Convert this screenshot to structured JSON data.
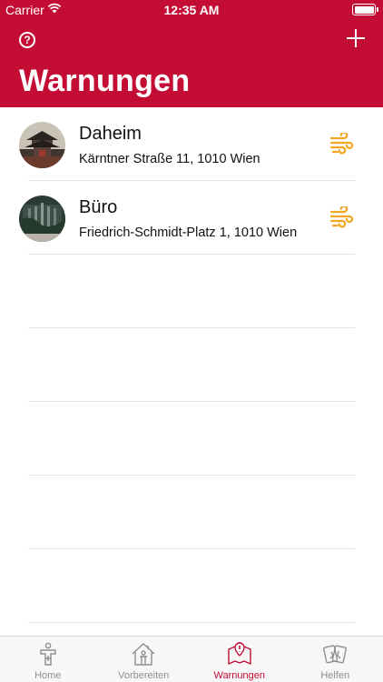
{
  "status_bar": {
    "carrier": "Carrier",
    "time": "12:35 AM"
  },
  "header": {
    "title": "Warnungen"
  },
  "locations": [
    {
      "name": "Daheim",
      "address": "Kärntner Straße 11, 1010 Wien",
      "warning_icon": "wind-icon"
    },
    {
      "name": "Büro",
      "address": "Friedrich-Schmidt-Platz 1, 1010 Wien",
      "warning_icon": "wind-icon"
    }
  ],
  "tabbar": {
    "tabs": [
      {
        "label": "Home",
        "icon": "first-aid-person-icon",
        "active": false
      },
      {
        "label": "Vorbereiten",
        "icon": "house-person-icon",
        "active": false
      },
      {
        "label": "Warnungen",
        "icon": "map-warning-icon",
        "active": true
      },
      {
        "label": "Helfen",
        "icon": "cards-icon",
        "active": false
      }
    ]
  },
  "colors": {
    "brand": "#c40d34",
    "warning": "#f2a623",
    "inactive": "#8e8e93"
  }
}
